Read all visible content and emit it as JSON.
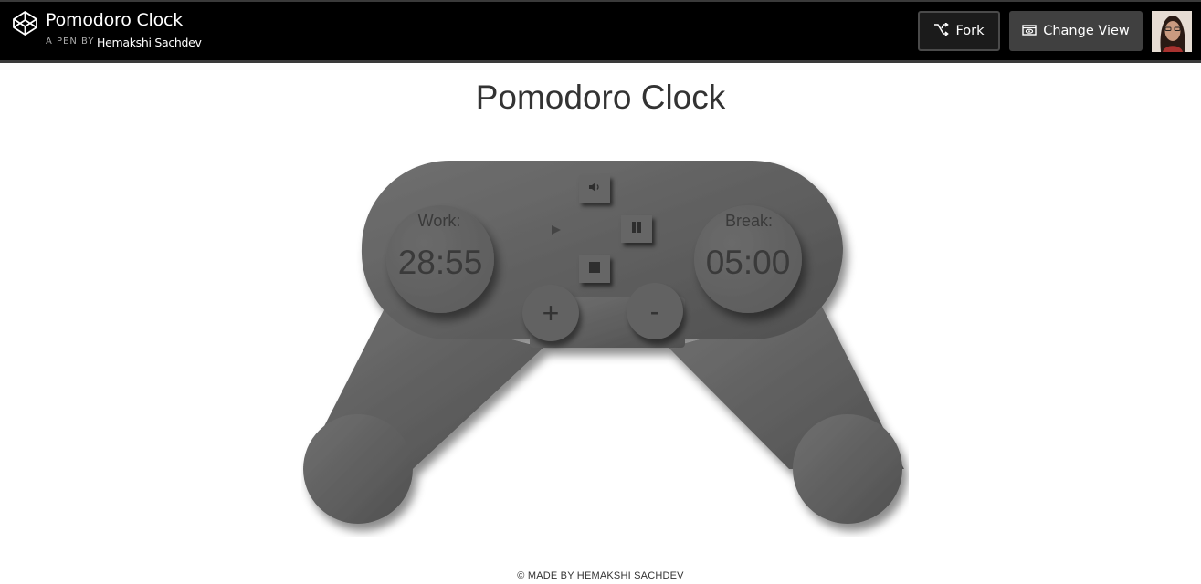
{
  "header": {
    "title": "Pomodoro Clock",
    "by_label": "A PEN BY",
    "author": "Hemakshi Sachdev",
    "fork_label": "Fork",
    "change_view_label": "Change View"
  },
  "page": {
    "heading": "Pomodoro Clock"
  },
  "timer": {
    "work_label": "Work:",
    "work_time": "28:55",
    "break_label": "Break:",
    "break_time": "05:00"
  },
  "controls": {
    "increase_label": "+",
    "decrease_label": "-",
    "icons": [
      "volume-icon",
      "play-icon",
      "pause-icon",
      "stop-icon"
    ]
  },
  "footer": {
    "text": "© MADE BY HEMAKSHI SACHDEV"
  },
  "colors": {
    "topbar": "#000000",
    "controller_body": "#5f5f5f",
    "page_background": "#ffffff"
  }
}
